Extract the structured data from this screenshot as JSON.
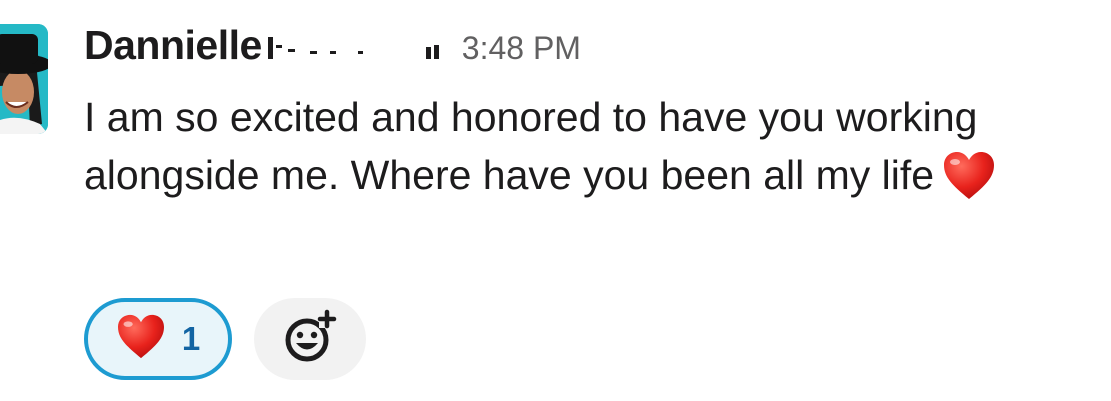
{
  "message": {
    "sender": "Dannielle",
    "timestamp": "3:48 PM",
    "body": "I am so excited and honored to have you working alongside me. Where have you been all my life",
    "inline_emoji": "heart-emoji"
  },
  "reactions": [
    {
      "emoji": "heart-emoji",
      "count": "1",
      "selected": true
    }
  ],
  "add_reaction_icon": "add-reaction-icon",
  "colors": {
    "accent_border": "#1d9bd1",
    "reaction_bg": "#e8f5fa",
    "count_text": "#1264a3",
    "heart": "#e0201e",
    "avatar_bg": "#25b9c6"
  }
}
